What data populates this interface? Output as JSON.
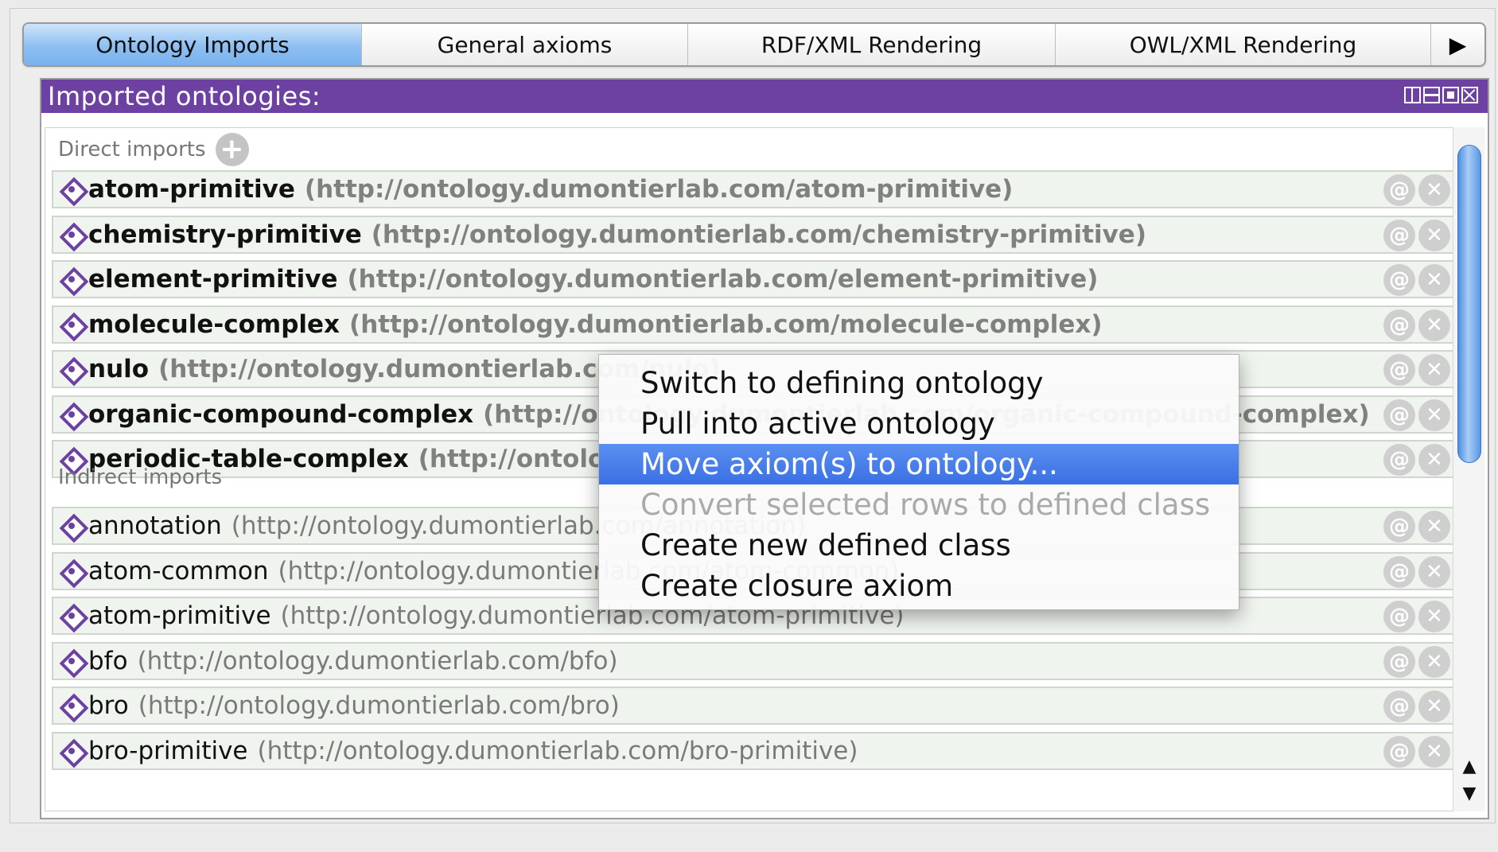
{
  "tabs": [
    {
      "label": "Ontology Imports",
      "active": true
    },
    {
      "label": "General axioms",
      "active": false
    },
    {
      "label": "RDF/XML Rendering",
      "active": false
    },
    {
      "label": "OWL/XML Rendering",
      "active": false
    }
  ],
  "tab_overflow_icon": "▶",
  "view": {
    "title": "Imported ontologies:",
    "controls": [
      "split-icon",
      "minimize-icon",
      "maximize-icon",
      "close-icon"
    ]
  },
  "direct": {
    "label": "Direct imports",
    "add_icon": "+",
    "rows": [
      {
        "name": "atom-primitive",
        "uri": "(http://ontology.dumontierlab.com/atom-primitive)"
      },
      {
        "name": "chemistry-primitive",
        "uri": "(http://ontology.dumontierlab.com/chemistry-primitive)"
      },
      {
        "name": "element-primitive",
        "uri": "(http://ontology.dumontierlab.com/element-primitive)"
      },
      {
        "name": "molecule-complex",
        "uri": "(http://ontology.dumontierlab.com/molecule-complex)"
      },
      {
        "name": "nulo",
        "uri": "(http://ontology.dumontierlab.com/nulo)"
      },
      {
        "name": "organic-compound-complex",
        "uri": "(http://ontology.dumontierlab.com/organic-compound-complex)"
      },
      {
        "name": "periodic-table-complex",
        "uri": "(http://ontology.dumontierlab.com/periodic-table-complex)"
      }
    ]
  },
  "indirect": {
    "label": "Indirect imports",
    "rows": [
      {
        "name": "annotation",
        "uri": "(http://ontology.dumontierlab.com/annotation)"
      },
      {
        "name": "atom-common",
        "uri": "(http://ontology.dumontierlab.com/atom-common)"
      },
      {
        "name": "atom-primitive",
        "uri": "(http://ontology.dumontierlab.com/atom-primitive)"
      },
      {
        "name": "bfo",
        "uri": "(http://ontology.dumontierlab.com/bfo)"
      },
      {
        "name": "bro",
        "uri": "(http://ontology.dumontierlab.com/bro)"
      },
      {
        "name": "bro-primitive",
        "uri": "(http://ontology.dumontierlab.com/bro-primitive)"
      }
    ]
  },
  "row_buttons": {
    "annotate": "@",
    "remove": "✕"
  },
  "scroll": {
    "up": "▲",
    "down": "▼"
  },
  "context_menu": {
    "items": [
      {
        "label": "Switch to defining ontology",
        "state": "normal"
      },
      {
        "label": "Pull into active ontology",
        "state": "normal"
      },
      {
        "label": "Move axiom(s) to ontology...",
        "state": "highlighted"
      },
      {
        "label": "Convert selected rows to defined class",
        "state": "disabled"
      },
      {
        "label": "Create new defined class",
        "state": "normal"
      },
      {
        "label": "Create closure axiom",
        "state": "normal"
      }
    ]
  },
  "colors": {
    "header_purple": "#6c41a2",
    "tab_active_blue": "#8ebff1",
    "menu_highlight": "#3a70e4",
    "row_bg": "#f0f4ee"
  }
}
